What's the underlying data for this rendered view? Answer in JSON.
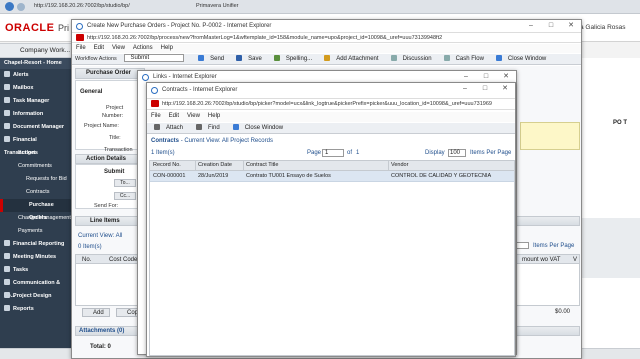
{
  "tabs": {
    "url1": "http://192.168.20.26:7002/bp/studio/bp/",
    "tab2": "Primavera Unifier"
  },
  "header": {
    "brand": "ORACLE",
    "product": "Pri",
    "user": "a Galicia Rosas"
  },
  "sidebar": {
    "company": "Company Work...",
    "project": "Chapel-Resort - Home",
    "items": [
      "Alerts",
      "Mailbox",
      "Task Manager",
      "Information",
      "Document Manager",
      "Financial Transactions"
    ],
    "sub": [
      "Budget",
      "Commitments",
      "Requests for Bid",
      "Contracts",
      "Purchase Orders",
      "Change Management",
      "Payments"
    ],
    "bottom": [
      "Financial Reporting",
      "Meeting Minutes",
      "Tasks",
      "Communication & Fo...",
      "Project Design",
      "Reports"
    ]
  },
  "po": {
    "title": "Create New Purchase Orders - Project No. P-0002 - Internet Explorer",
    "url": "http://192.168.20.26:7002/bp/process/new?fromMasterLog=1&wftemplate_id=158&module_name=upo&project_id=10098&_uref=uuu73139948ft2",
    "menu": [
      "File",
      "Edit",
      "View",
      "Actions",
      "Help"
    ],
    "workflow_label": "Workflow Actions",
    "workflow_value": "Submit",
    "toolbar": [
      "Send",
      "Save",
      "Spelling...",
      "Add Attachment",
      "Discussion",
      "Cash Flow",
      "Close Window"
    ],
    "section": "Purchase Order",
    "general": "General",
    "fields": [
      "Project",
      "Number:",
      "Project Name:",
      "Title:"
    ],
    "dir": "Dir",
    "transaction": "Transaction",
    "action_details": "Action Details",
    "submit": "Submit",
    "to": "To...",
    "cc": "Cc...",
    "send_for": "Send For:",
    "line_items": "Line Items",
    "current_view": "Current View: All",
    "items_count": "0  Item(s)",
    "cols": [
      "No.",
      "Cost Code"
    ],
    "add": "Add",
    "copy": "Copy",
    "attachments": "Attachments (0)",
    "total": "Total: 0",
    "right_col": "PO T",
    "items_per_page": "Items Per Page",
    "amount_col": "mount wo VAT",
    "amount_val": "$0.00",
    "v": "V"
  },
  "links": {
    "title": "Links - Internet Explorer"
  },
  "contracts": {
    "title": "Contracts - Internet Explorer",
    "url": "http://192.168.20.26:7002/bp/studio/bp/picker?model=ucx&link_logtrue&pickerPrefix=picker&uuu_location_id=10098&_uref=uuu731969",
    "menu": [
      "File",
      "Edit",
      "View",
      "Help"
    ],
    "toolbar": [
      "Attach",
      "Find",
      "Close Window"
    ],
    "view_label": "Contracts",
    "view_text": "- Current View:  All Project Records",
    "count": "1  Item(s)",
    "page_label": "Page",
    "page_value": "1",
    "page_of": "of",
    "page_total": "1",
    "display_label": "Display",
    "display_value": "100",
    "per_page": "Items Per Page",
    "columns": [
      "Record No.",
      "Creation Date",
      "Contract Title",
      "Vendor"
    ],
    "rows": [
      [
        "CON-000001",
        "28/Jun/2019",
        "Contrato TU001 Ensayo de Suelos",
        "CONTROL DE CALIDAD Y GEOTECNIA"
      ]
    ]
  },
  "colors": {
    "accent": "#c00",
    "blue": "#1f4e8c",
    "sidebar": "#2f3e4f"
  }
}
